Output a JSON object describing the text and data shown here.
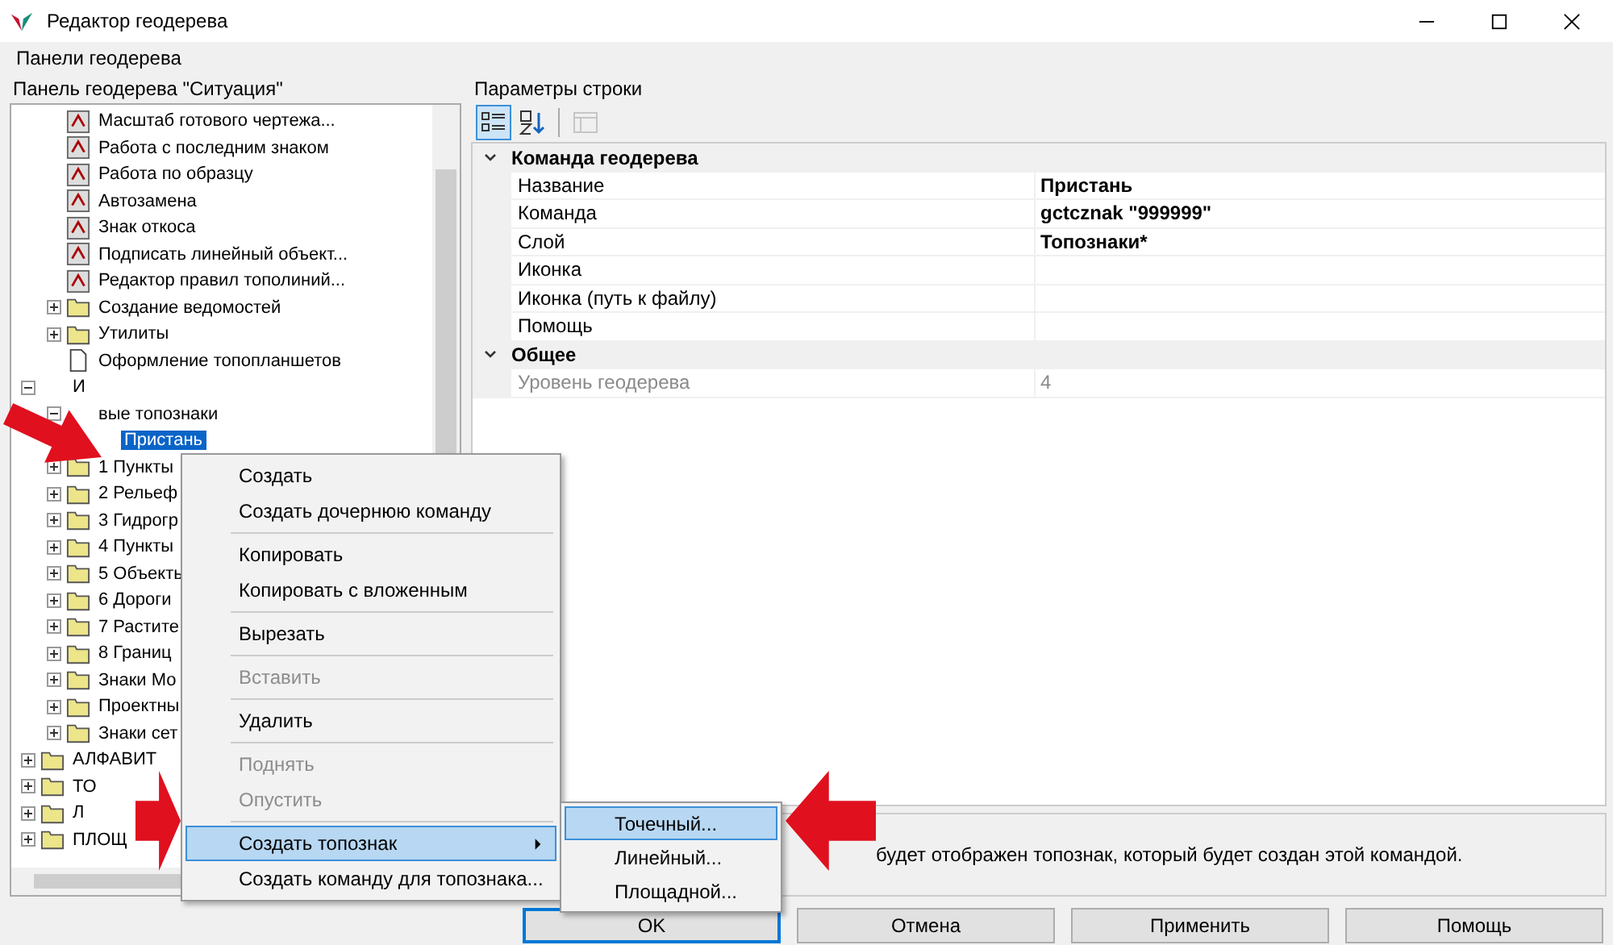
{
  "window": {
    "title": "Редактор геодерева"
  },
  "menu_bar": [
    "Панели геодерева"
  ],
  "left_panel": {
    "title": "Панель геодерева \"Ситуация\"",
    "tree": [
      {
        "children": [
          {
            "label": "Масштаб готового чертежа...",
            "kind": "command"
          },
          {
            "label": "Работа с последним знаком",
            "kind": "command"
          },
          {
            "label": "Работа по образцу",
            "kind": "command"
          },
          {
            "label": "Автозамена",
            "kind": "command"
          },
          {
            "label": "Знак откоса",
            "kind": "command"
          },
          {
            "label": "Подписать линейный объект...",
            "kind": "command"
          },
          {
            "label": "Редактор правил тополиний...",
            "kind": "command"
          },
          {
            "label": "Создание ведомостей",
            "kind": "folder",
            "expanded": false
          },
          {
            "label": "Утилиты",
            "kind": "folder",
            "expanded": false
          },
          {
            "label": "Оформление топопланшетов",
            "kind": "document"
          }
        ]
      },
      {
        "label": "И",
        "expanded": true,
        "children": [
          {
            "label": "вые топознаки",
            "expanded": true,
            "children": [
              {
                "label": "Пристань",
                "selected": true
              }
            ]
          },
          {
            "label": "1 Пункты",
            "kind": "folder",
            "expanded": false
          },
          {
            "label": "2 Рельеф",
            "kind": "folder",
            "expanded": false
          },
          {
            "label": "3 Гидрогр",
            "kind": "folder",
            "expanded": false
          },
          {
            "label": "4 Пункты",
            "kind": "folder",
            "expanded": false
          },
          {
            "label": "5 Объекть",
            "kind": "folder",
            "expanded": false
          },
          {
            "label": "6 Дороги",
            "kind": "folder",
            "expanded": false
          },
          {
            "label": "7 Растите",
            "kind": "folder",
            "expanded": false
          },
          {
            "label": "8 Границ",
            "kind": "folder",
            "expanded": false
          },
          {
            "label": "Знаки Мо",
            "kind": "folder",
            "expanded": false
          },
          {
            "label": "Проектны",
            "kind": "folder",
            "expanded": false
          },
          {
            "label": "Знаки сет",
            "kind": "folder",
            "expanded": false
          }
        ]
      },
      {
        "label": "АЛФАВИТ",
        "kind": "folder",
        "expanded": false
      },
      {
        "label": "ТО",
        "kind": "folder",
        "expanded": false
      },
      {
        "label": "Л",
        "kind": "folder",
        "expanded": false
      },
      {
        "label": "ПЛОЩ",
        "kind": "folder",
        "expanded": false
      }
    ]
  },
  "right_panel": {
    "title": "Параметры строки",
    "toolbar": [
      {
        "kind": "categorized",
        "selected": true
      },
      {
        "kind": "alphabetical",
        "selected": false
      },
      {
        "kind": "pages",
        "disabled": true
      }
    ],
    "categories": [
      {
        "name": "Команда геодерева",
        "expanded": true,
        "rows": [
          {
            "name": "Название",
            "value": "Пристань",
            "disabled": false
          },
          {
            "name": "Команда",
            "value": "gctcznak \"999999\"",
            "disabled": false
          },
          {
            "name": "Слой",
            "value": "Топознаки*",
            "disabled": false
          },
          {
            "name": "Иконка",
            "disabled": false
          },
          {
            "name": "Иконка (путь к файлу)",
            "disabled": false
          },
          {
            "name": "Помощь",
            "disabled": false
          }
        ]
      },
      {
        "name": "Общее",
        "expanded": true,
        "rows": [
          {
            "name": "Уровень геодерева",
            "value": "4",
            "disabled": true
          }
        ]
      }
    ],
    "description": "будет отображен топознак, который будет создан этой командой."
  },
  "context_menu": [
    {
      "kind": "item",
      "label": "Создать",
      "disabled": false,
      "selected": false
    },
    {
      "kind": "item",
      "label": "Создать дочернюю команду",
      "disabled": false,
      "selected": false
    },
    {
      "kind": "separator"
    },
    {
      "kind": "item",
      "label": "Копировать",
      "disabled": false,
      "selected": false
    },
    {
      "kind": "item",
      "label": "Копировать с вложенным",
      "disabled": false,
      "selected": false
    },
    {
      "kind": "separator"
    },
    {
      "kind": "item",
      "label": "Вырезать",
      "disabled": false,
      "selected": false
    },
    {
      "kind": "separator"
    },
    {
      "kind": "item",
      "label": "Вставить",
      "disabled": true,
      "selected": false
    },
    {
      "kind": "separator"
    },
    {
      "kind": "item",
      "label": "Удалить",
      "disabled": false,
      "selected": false
    },
    {
      "kind": "separator"
    },
    {
      "kind": "item",
      "label": "Поднять",
      "disabled": true,
      "selected": false
    },
    {
      "kind": "item",
      "label": "Опустить",
      "disabled": true,
      "selected": false
    },
    {
      "kind": "separator"
    },
    {
      "kind": "submenu",
      "label": "Создать топознак",
      "disabled": false,
      "selected": true
    },
    {
      "kind": "item",
      "label": "Создать команду для топознака...",
      "disabled": false,
      "selected": false
    }
  ],
  "submenu": [
    {
      "label": "Точечный...",
      "selected": true
    },
    {
      "label": "Линейный...",
      "selected": false
    },
    {
      "label": "Площадной...",
      "selected": false
    }
  ],
  "buttons": [
    {
      "label": "OK",
      "default": true
    },
    {
      "label": "Отмена",
      "default": false
    },
    {
      "label": "Применить",
      "default": false
    },
    {
      "label": "Помощь",
      "default": false
    }
  ]
}
